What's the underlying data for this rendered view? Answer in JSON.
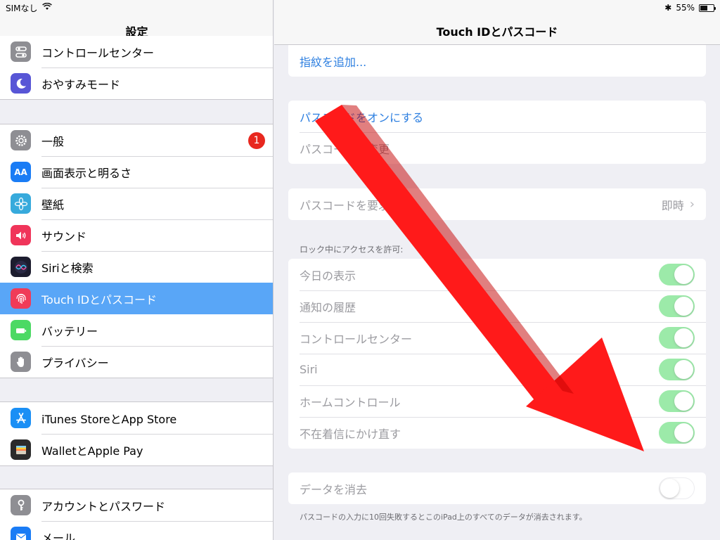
{
  "status": {
    "carrier": "SIMなし",
    "battery_percent": "55%",
    "battery_level": 0.55
  },
  "sidebar": {
    "title": "設定",
    "groups": [
      {
        "items": [
          {
            "label": "コントロールセンター",
            "icon": "control-center-icon",
            "color": "#8e8e93"
          },
          {
            "label": "おやすみモード",
            "icon": "moon-icon",
            "color": "#5856d6"
          }
        ]
      },
      {
        "items": [
          {
            "label": "一般",
            "icon": "gear-icon",
            "color": "#8e8e93",
            "badge": "1"
          },
          {
            "label": "画面表示と明るさ",
            "icon": "text-size-icon",
            "color": "#1a7cf5"
          },
          {
            "label": "壁紙",
            "icon": "flower-icon",
            "color": "#37aadc"
          },
          {
            "label": "サウンド",
            "icon": "speaker-icon",
            "color": "#f0355a"
          },
          {
            "label": "Siriと検索",
            "icon": "siri-icon",
            "color": "#1c1c2e"
          },
          {
            "label": "Touch IDとパスコード",
            "icon": "fingerprint-icon",
            "color": "#f03b58",
            "selected": true
          },
          {
            "label": "バッテリー",
            "icon": "battery-icon",
            "color": "#4cd964"
          },
          {
            "label": "プライバシー",
            "icon": "hand-icon",
            "color": "#8e8e93"
          }
        ]
      },
      {
        "items": [
          {
            "label": "iTunes StoreとApp Store",
            "icon": "app-store-icon",
            "color": "#1a8ff5"
          },
          {
            "label": "WalletとApple Pay",
            "icon": "wallet-icon",
            "color": "#2b2b2b"
          }
        ]
      },
      {
        "items": [
          {
            "label": "アカウントとパスワード",
            "icon": "key-icon",
            "color": "#8e8e93"
          },
          {
            "label": "メール",
            "icon": "mail-icon",
            "color": "#1a7cf5"
          }
        ]
      }
    ]
  },
  "detail": {
    "title": "Touch IDとパスコード",
    "add_fingerprint": "指紋を追加...",
    "passcode_on": "パスコードをオンにする",
    "passcode_change": "パスコードを変更",
    "require_passcode": {
      "label": "パスコードを要求",
      "value": "即時"
    },
    "lock_access_header": "ロック中にアクセスを許可:",
    "lock_access_items": [
      {
        "label": "今日の表示",
        "on": true
      },
      {
        "label": "通知の履歴",
        "on": true
      },
      {
        "label": "コントロールセンター",
        "on": true
      },
      {
        "label": "Siri",
        "on": true
      },
      {
        "label": "ホームコントロール",
        "on": true
      },
      {
        "label": "不在着信にかけ直す",
        "on": true
      }
    ],
    "erase_data": {
      "label": "データを消去",
      "on": false
    },
    "erase_footnote": "パスコードの入力に10回失敗するとこのiPad上のすべてのデータが消去されます。"
  },
  "colors": {
    "accent": "#2d7fe0",
    "selected_row": "#59a6f7",
    "toggle_on": "#4cd964",
    "annotation_arrow": "#ff1a1a"
  }
}
